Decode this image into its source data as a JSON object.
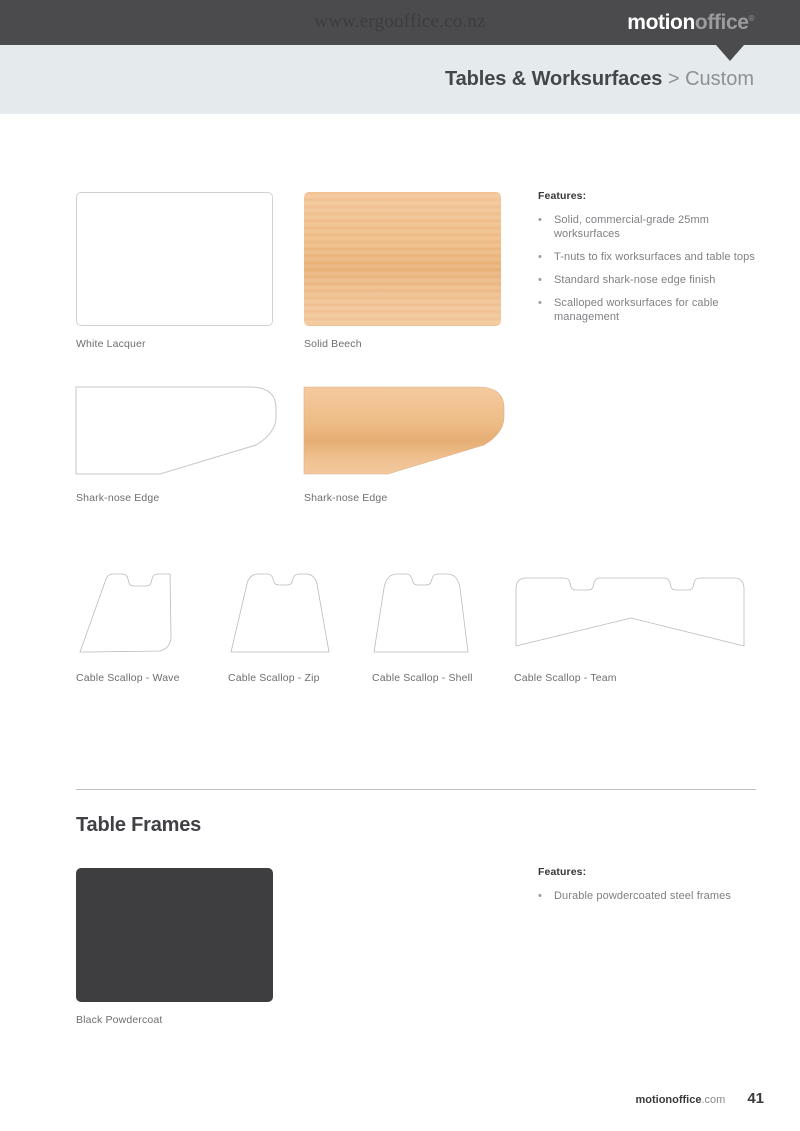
{
  "header": {
    "site_url": "www.ergooffice.co.nz",
    "logo_primary": "motion",
    "logo_secondary": "office",
    "logo_registered": "®",
    "breadcrumb_strong": "Tables & Worksurfaces",
    "breadcrumb_separator": ">",
    "breadcrumb_current": "Custom",
    "band_color": "#4b4b4d",
    "subband_color": "#e5eaed"
  },
  "main": {
    "finishes": [
      {
        "label": "White Lacquer",
        "color": "#ffffff",
        "kind": "solid-bordered"
      },
      {
        "label": "Solid Beech",
        "color": "#eebd87",
        "kind": "wood"
      }
    ],
    "edge_profiles": [
      {
        "label": "Shark-nose Edge",
        "fill": "#ffffff",
        "kind": "outline"
      },
      {
        "label": "Shark-nose Edge",
        "fill": "#eebd87",
        "kind": "wood"
      }
    ],
    "cable_scallops": [
      {
        "label": "Cable Scallop - Wave"
      },
      {
        "label": "Cable Scallop - Zip"
      },
      {
        "label": "Cable Scallop - Shell"
      },
      {
        "label": "Cable Scallop - Team"
      }
    ],
    "features": {
      "title": "Features:",
      "items": [
        "Solid, commercial-grade 25mm worksurfaces",
        "T-nuts to fix worksurfaces and table tops",
        "Standard shark-nose edge finish",
        "Scalloped worksurfaces for cable management"
      ]
    }
  },
  "table_frames": {
    "section_title": "Table Frames",
    "swatch": {
      "label": "Black Powdercoat",
      "color": "#3e3e40"
    },
    "features": {
      "title": "Features:",
      "items": [
        "Durable powdercoated steel frames"
      ]
    }
  },
  "footer": {
    "brand_bold": "motionoffice",
    "brand_light": ".com",
    "page_number": "41"
  }
}
